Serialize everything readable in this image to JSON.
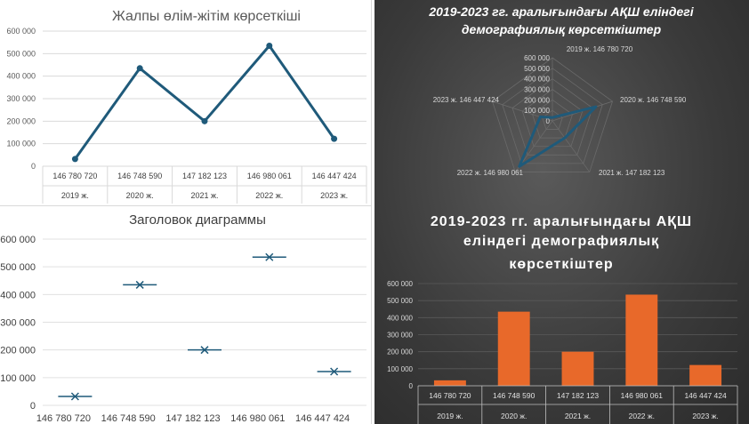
{
  "chart_data": [
    {
      "type": "line",
      "title": "Жалпы өлім-жітім көрсеткіші",
      "categories": [
        "146 780 720",
        "146 748 590",
        "147 182 123",
        "146 980 061",
        "146 447 424"
      ],
      "years": [
        "2019 ж.",
        "2020 ж.",
        "2021 ж.",
        "2022 ж.",
        "2023 ж."
      ],
      "values": [
        32000,
        435000,
        200000,
        535000,
        122000
      ],
      "yticks": [
        "0",
        "100 000",
        "200 000",
        "300 000",
        "400 000",
        "500 000",
        "600 000"
      ],
      "ylim": [
        0,
        600000
      ],
      "color": "#1f5a7a"
    },
    {
      "type": "scatter",
      "title": "Заголовок диаграммы",
      "categories": [
        "146 780 720",
        "146 748 590",
        "147 182 123",
        "146 980 061",
        "146 447 424"
      ],
      "values": [
        32000,
        435000,
        200000,
        535000,
        122000
      ],
      "yticks": [
        "0",
        "100 000",
        "200 000",
        "300 000",
        "400 000",
        "500 000",
        "600 000"
      ],
      "ylim": [
        0,
        600000
      ],
      "color": "#1f5a7a"
    },
    {
      "type": "radar",
      "title_lines": [
        "2019-2023 гг. аралығындағы АҚШ еліндегі",
        "демографиялық көрсеткіштер"
      ],
      "axis_labels": [
        "2019 ж. 146 780 720",
        "2020 ж. 146 748 590",
        "2021 ж. 147 182 123",
        "2022 ж. 146 980 061",
        "2023 ж. 146 447 424"
      ],
      "values": [
        32000,
        435000,
        200000,
        535000,
        122000
      ],
      "rticks": [
        "0",
        "100 000",
        "200 000",
        "300 000",
        "400 000",
        "500 000",
        "600 000"
      ],
      "rlim": [
        0,
        600000
      ],
      "color": "#1f5a7a"
    },
    {
      "type": "bar",
      "title_lines": [
        "2019-2023 гг. аралығындағы АҚШ",
        "еліндегі демографиялық",
        "көрсеткіштер"
      ],
      "categories": [
        "146 780 720",
        "146 748 590",
        "147 182 123",
        "146 980 061",
        "146 447 424"
      ],
      "years": [
        "2019 ж.",
        "2020 ж.",
        "2021 ж.",
        "2022 ж.",
        "2023 ж."
      ],
      "values": [
        32000,
        435000,
        200000,
        535000,
        122000
      ],
      "yticks": [
        "0",
        "100 000",
        "200 000",
        "300 000",
        "400 000",
        "500 000",
        "600 000"
      ],
      "ylim": [
        0,
        600000
      ],
      "color": "#e8692a"
    }
  ]
}
